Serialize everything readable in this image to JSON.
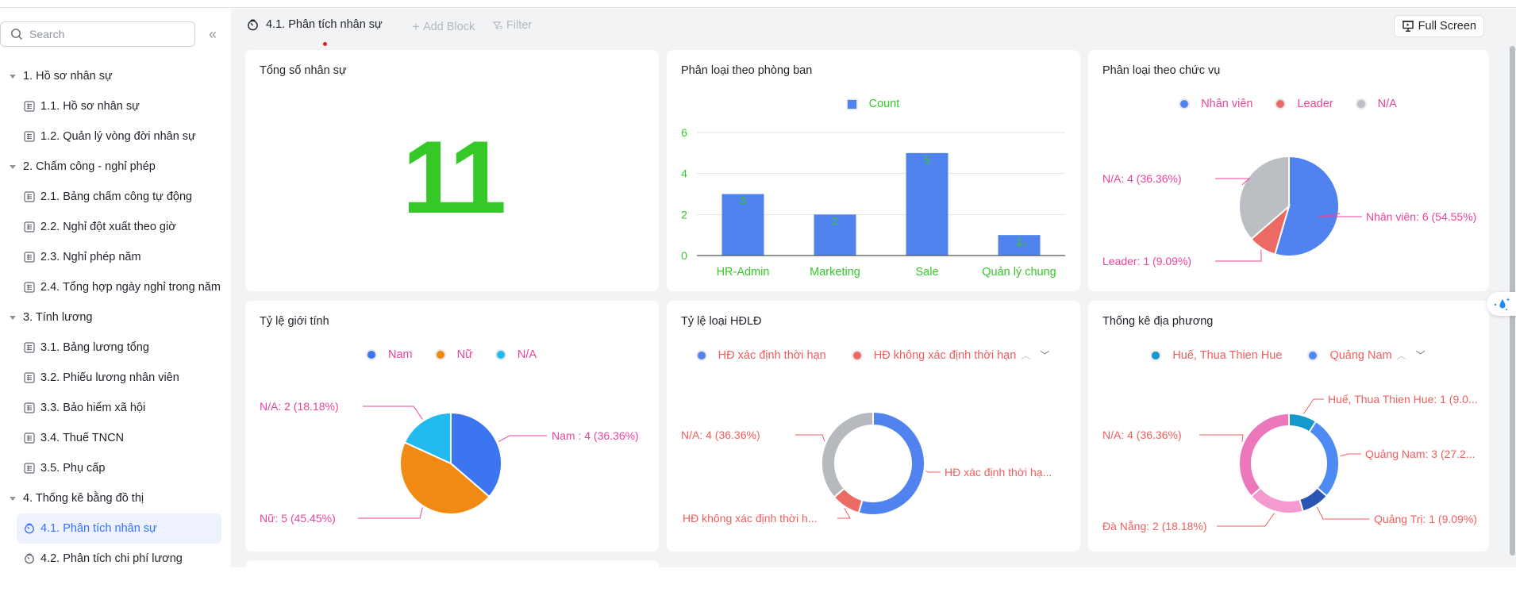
{
  "sidebar": {
    "search_placeholder": "Search",
    "collapse_icon": "double-chevron-left-icon",
    "items": [
      {
        "type": "group",
        "label": "1. Hồ sơ nhân sự"
      },
      {
        "type": "table",
        "label": "1.1. Hồ sơ nhân sự"
      },
      {
        "type": "table",
        "label": "1.2. Quản lý vòng đời nhân sự"
      },
      {
        "type": "group",
        "label": "2. Chấm công - nghỉ phép"
      },
      {
        "type": "table",
        "label": "2.1. Bảng chấm công tự động"
      },
      {
        "type": "table",
        "label": "2.2. Nghỉ đột xuất theo giờ"
      },
      {
        "type": "table",
        "label": "2.3. Nghỉ phép năm"
      },
      {
        "type": "table",
        "label": "2.4. Tổng hợp ngày nghỉ trong năm"
      },
      {
        "type": "group",
        "label": "3. Tính lương"
      },
      {
        "type": "table",
        "label": "3.1. Bảng lương tổng"
      },
      {
        "type": "table",
        "label": "3.2. Phiếu lương nhân viên"
      },
      {
        "type": "table",
        "label": "3.3. Bảo hiểm xã hội"
      },
      {
        "type": "table",
        "label": "3.4. Thuế TNCN"
      },
      {
        "type": "table",
        "label": "3.5. Phụ cấp"
      },
      {
        "type": "group",
        "label": "4. Thống kê bằng đồ thị"
      },
      {
        "type": "dashboard",
        "label": "4.1. Phân tích nhân sự",
        "active": true
      },
      {
        "type": "dashboard",
        "label": "4.2. Phân tích chi phí lương"
      }
    ]
  },
  "toolbar": {
    "title": "4.1. Phân tích nhân sự",
    "add_block": "Add Block",
    "filter": "Filter",
    "full_screen": "Full Screen"
  },
  "colors": {
    "accent": "#3370ff",
    "green": "#35c827",
    "pink_label": "#e8459b",
    "salmon_label": "#f05e5e"
  },
  "cards": {
    "total": {
      "title": "Tổng số nhân sự",
      "value": "11"
    },
    "department": {
      "title": "Phân loại theo phòng ban"
    },
    "position": {
      "title": "Phân loại theo chức vụ"
    },
    "gender": {
      "title": "Tỷ lệ giới tính"
    },
    "contract": {
      "title": "Tỷ lệ loại HĐLĐ"
    },
    "region": {
      "title": "Thống kê địa phương"
    }
  },
  "chart_data": [
    {
      "id": "department",
      "type": "bar",
      "title": "Phân loại theo phòng ban",
      "legend": [
        "Count"
      ],
      "categories": [
        "HR-Admin",
        "Marketing",
        "Sale",
        "Quản lý chung"
      ],
      "values": [
        3,
        2,
        5,
        1
      ],
      "yticks": [
        0,
        2,
        4,
        6
      ],
      "ylim": [
        0,
        6
      ],
      "grid": true,
      "legend_position": "top-center",
      "color": "#5183f0"
    },
    {
      "id": "position",
      "type": "pie",
      "title": "Phân loại theo chức vụ",
      "legend_position": "top-center",
      "slices": [
        {
          "name": "Nhân viên",
          "value": 6,
          "percent": "54.55%",
          "color": "#5183f0",
          "label": "Nhân viên: 6 (54.55%)"
        },
        {
          "name": "Leader",
          "value": 1,
          "percent": "9.09%",
          "color": "#eb6b64",
          "label": "Leader: 1 (9.09%)"
        },
        {
          "name": "N/A",
          "value": 4,
          "percent": "36.36%",
          "color": "#bbbec3",
          "label": "N/A: 4 (36.36%)"
        }
      ]
    },
    {
      "id": "gender",
      "type": "pie",
      "title": "Tỷ lệ giới tính",
      "legend_position": "top-center",
      "slices": [
        {
          "name": "Nam",
          "value": 4,
          "percent": "36.36%",
          "color": "#3b75ef",
          "label": "Nam : 4 (36.36%)"
        },
        {
          "name": "Nữ",
          "value": 5,
          "percent": "45.45%",
          "color": "#f08a12",
          "label": "Nữ: 5 (45.45%)"
        },
        {
          "name": "N/A",
          "value": 2,
          "percent": "18.18%",
          "color": "#22bbef",
          "label": "N/A: 2 (18.18%)"
        }
      ]
    },
    {
      "id": "contract",
      "type": "donut",
      "title": "Tỷ lệ loại HĐLĐ",
      "legend_position": "top-center",
      "legend_visible": [
        "HĐ xác định thời hạn",
        "HĐ không xác định thời hạn"
      ],
      "slices": [
        {
          "name": "HĐ xác định thời hạn",
          "value": 6,
          "color": "#5183f0",
          "label": "HĐ xác định thời hạ..."
        },
        {
          "name": "HĐ không xác định thời hạn",
          "value": 1,
          "color": "#eb6b64",
          "label": "HĐ không xác định thời h..."
        },
        {
          "name": "N/A",
          "value": 4,
          "percent": "36.36%",
          "color": "#b6b9be",
          "label": "N/A: 4 (36.36%)"
        }
      ]
    },
    {
      "id": "region",
      "type": "donut",
      "title": "Thống kê địa phương",
      "legend_position": "top-center",
      "legend_visible": [
        "Huế, Thua Thien Hue",
        "Quảng Nam"
      ],
      "slices": [
        {
          "name": "Huế, Thua Thien Hue",
          "value": 1,
          "color": "#1598cc",
          "label": "Huế, Thua Thien Hue: 1 (9.0..."
        },
        {
          "name": "Quảng Nam",
          "value": 3,
          "color": "#4e8af5",
          "label": "Quảng Nam: 3 (27.2..."
        },
        {
          "name": "Quảng Trị",
          "value": 1,
          "percent": "9.09%",
          "color": "#2855b4",
          "label": "Quảng Trị: 1 (9.09%)"
        },
        {
          "name": "Đà Nẵng",
          "value": 2,
          "percent": "18.18%",
          "color": "#f39ad0",
          "label": "Đà Nẵng: 2 (18.18%)"
        },
        {
          "name": "N/A",
          "value": 4,
          "percent": "36.36%",
          "color": "#ec78bb",
          "label": "N/A: 4 (36.36%)"
        }
      ]
    }
  ]
}
